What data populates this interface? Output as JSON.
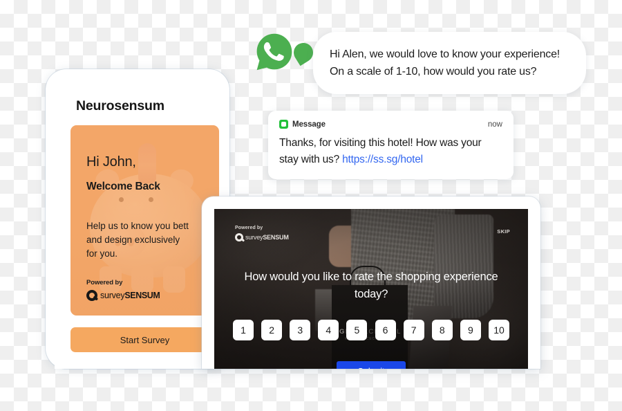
{
  "colors": {
    "whatsapp_green": "#4caf50",
    "sms_green": "#22c03a",
    "card_orange": "#f3a96d",
    "button_orange": "#f5a860",
    "submit_blue": "#1a47e8",
    "link_blue": "#3367f0"
  },
  "phone": {
    "app_title": "Neurosensum",
    "greeting": "Hi John,",
    "welcome": "Welcome Back",
    "help_text": "Help us to know you bett",
    "help_text_line2": "and design exclusively",
    "help_text_line3": "for you.",
    "powered_label": "Powered by",
    "brand_light": "survey",
    "brand_bold": "SENSUM",
    "start_button": "Start Survey"
  },
  "whatsapp": {
    "icon": "whatsapp-icon",
    "line1": "Hi Alen, we would love to know your experience!",
    "line2": "On a scale of 1-10, how would you rate us?"
  },
  "sms": {
    "app_icon": "message-app-icon",
    "app_name": "Message",
    "time": "now",
    "body": "Thanks, for visiting this hotel! How was your stay with us? ",
    "link": "https://ss.sg/hotel"
  },
  "tablet": {
    "powered_label": "Powered by",
    "brand_light": "survey",
    "brand_bold": "SENSUM",
    "skip_label": "SKIP",
    "question": "How would you like to rate the shopping experience today?",
    "scale": [
      "1",
      "2",
      "3",
      "4",
      "5",
      "6",
      "7",
      "8",
      "9",
      "10"
    ],
    "submit_label": "Submit",
    "bag_brand_bold": "GRACE",
    "bag_brand_light": "CHAPEL",
    "bag_sub": "WWW.GRACECHAPEL.US"
  }
}
